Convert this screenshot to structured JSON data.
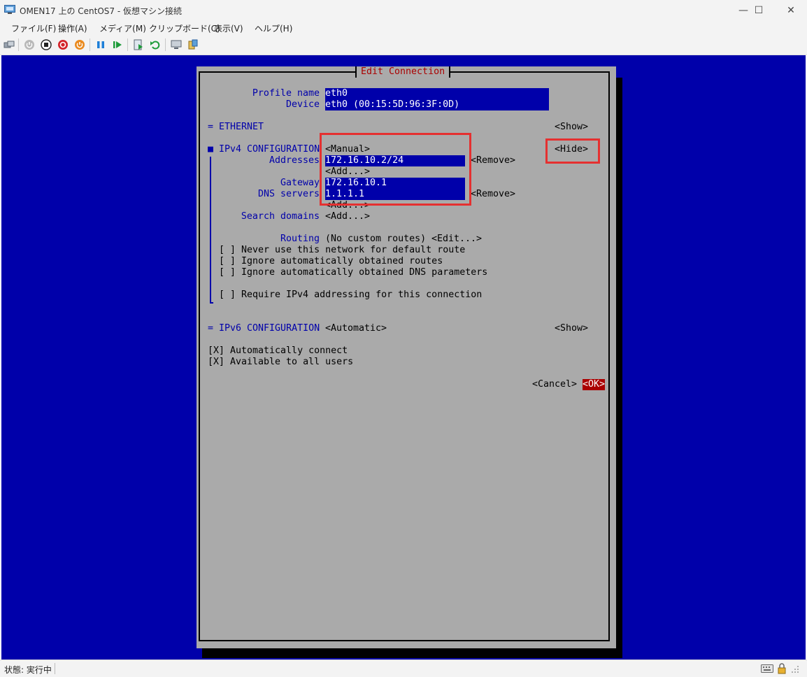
{
  "window": {
    "title": "OMEN17 上の CentOS7 - 仮想マシン接続",
    "minimize": "—",
    "maximize": "☐",
    "close": "✕"
  },
  "menu": [
    "ファイル(F)",
    "操作(A)",
    "メディア(M)",
    "クリップボード(C)",
    "表示(V)",
    "ヘルプ(H)"
  ],
  "toolbar": {
    "icons": [
      "ctrl-alt-del-icon",
      "start-icon",
      "turn-off-icon",
      "shutdown-icon",
      "power-icon",
      "pause-icon",
      "resume-icon",
      "checkpoint-icon",
      "revert-icon",
      "enhanced-session-icon",
      "share-icon"
    ]
  },
  "dialog": {
    "title": "Edit Connection",
    "profile_name_label": "Profile name",
    "profile_name_value": "eth0",
    "device_label": "Device",
    "device_value": "eth0 (00:15:5D:96:3F:0D)",
    "ethernet_marker": "=",
    "ethernet_label": "ETHERNET",
    "ethernet_toggle": "<Show>",
    "ipv4_marker": "■",
    "ipv4_label": "IPv4 CONFIGURATION",
    "ipv4_mode": "<Manual>",
    "ipv4_toggle": "<Hide>",
    "addresses_label": "Addresses",
    "address_value": "172.16.10.2/24",
    "remove_label": "<Remove>",
    "add_label": "<Add...>",
    "gateway_label": "Gateway",
    "gateway_value": "172.16.10.1",
    "dns_label": "DNS servers",
    "dns_value": "1.1.1.1",
    "search_domains_label": "Search domains",
    "routing_label": "Routing",
    "routing_value": "(No custom routes)",
    "edit_label": "<Edit...>",
    "checkbox_unchecked": "[ ]",
    "checkbox_checked": "[X]",
    "never_default_label": "Never use this network for default route",
    "ignore_routes_label": "Ignore automatically obtained routes",
    "ignore_dns_label": "Ignore automatically obtained DNS parameters",
    "require_ipv4_label": "Require IPv4 addressing for this connection",
    "ipv6_marker": "=",
    "ipv6_label": "IPv6 CONFIGURATION",
    "ipv6_mode": "<Automatic>",
    "ipv6_toggle": "<Show>",
    "auto_connect_label": "Automatically connect",
    "all_users_label": "Available to all users",
    "cancel_label": "<Cancel>",
    "ok_label": "<OK>"
  },
  "status": {
    "text": "状態: 実行中"
  },
  "colors": {
    "console_blue": "#0000aa",
    "dialog_gray": "#aaaaaa",
    "title_red": "#aa0000",
    "highlight_red": "#e53030"
  }
}
